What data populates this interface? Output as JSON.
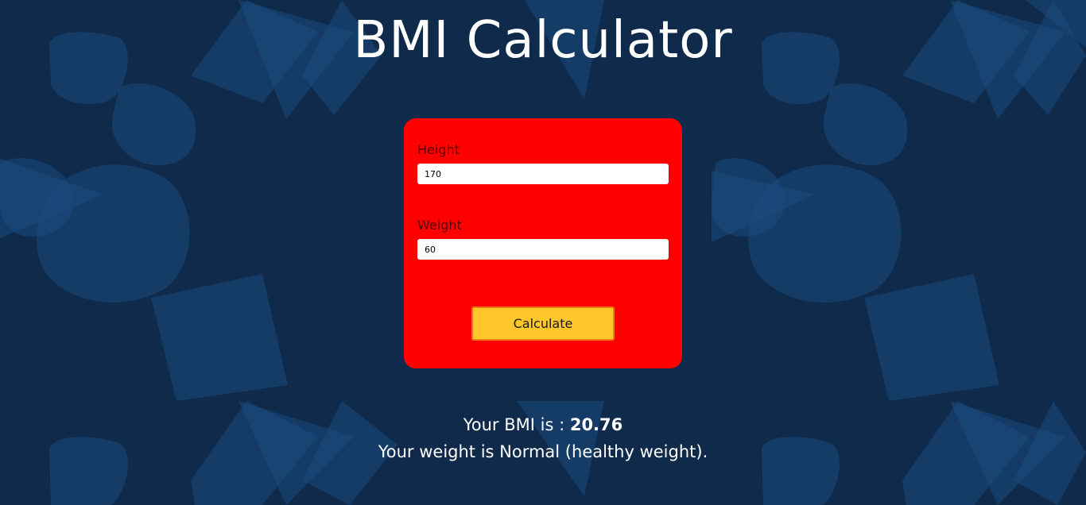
{
  "page": {
    "title": "BMI Calculator"
  },
  "form": {
    "height_label": "Height",
    "height_value": "170",
    "weight_label": "Weight",
    "weight_value": "60",
    "calculate_label": "Calculate"
  },
  "result": {
    "bmi_prefix": "Your BMI is : ",
    "bmi_value": "20.76",
    "category_text": "Your weight is Normal (healthy weight)."
  },
  "colors": {
    "background": "#0f2a4a",
    "shape": "#1b4a80",
    "card": "#ff0000",
    "button": "#ffc72c",
    "button_border": "#f07b12"
  }
}
